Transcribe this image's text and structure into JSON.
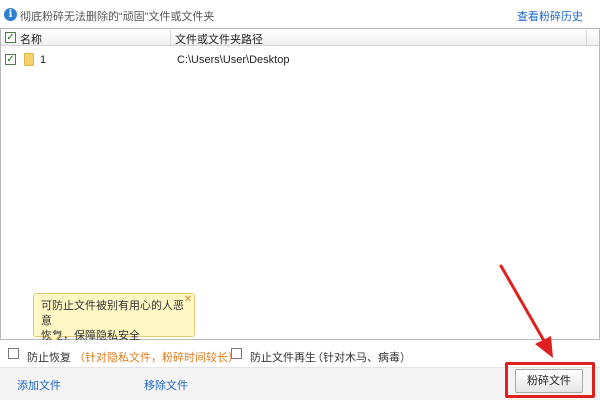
{
  "top": {
    "info_icon": "info-icon",
    "title": "彻底粉碎无法删除的“顽固”文件或文件夹",
    "history_link": "查看粉碎历史"
  },
  "table": {
    "header": {
      "name": "名称",
      "path": "文件或文件夹路径",
      "select_all_checked": true
    },
    "rows": [
      {
        "checked": true,
        "icon": "folder-icon",
        "name": "1",
        "path": "C:\\Users\\User\\Desktop"
      }
    ]
  },
  "tooltip": {
    "text_line1": "可防止文件被别有用心的人恶意",
    "text_line2": "恢复，保障隐私安全",
    "close_icon": "close-icon"
  },
  "options": {
    "prevent_restore": {
      "label": "防止恢复",
      "note": "（针对隐私文件，粉碎时间较长）",
      "checked": false
    },
    "prevent_regen": {
      "label": "防止文件再生",
      "note": "（针对木马、病毒）",
      "checked": false
    }
  },
  "footer": {
    "add_file": "添加文件",
    "remove_file": "移除文件",
    "shred_button": "粉碎文件"
  },
  "colors": {
    "link": "#1e66c4",
    "highlight": "#e02020",
    "note": "#e07b1f",
    "tooltip_bg": "#fff8c4"
  }
}
